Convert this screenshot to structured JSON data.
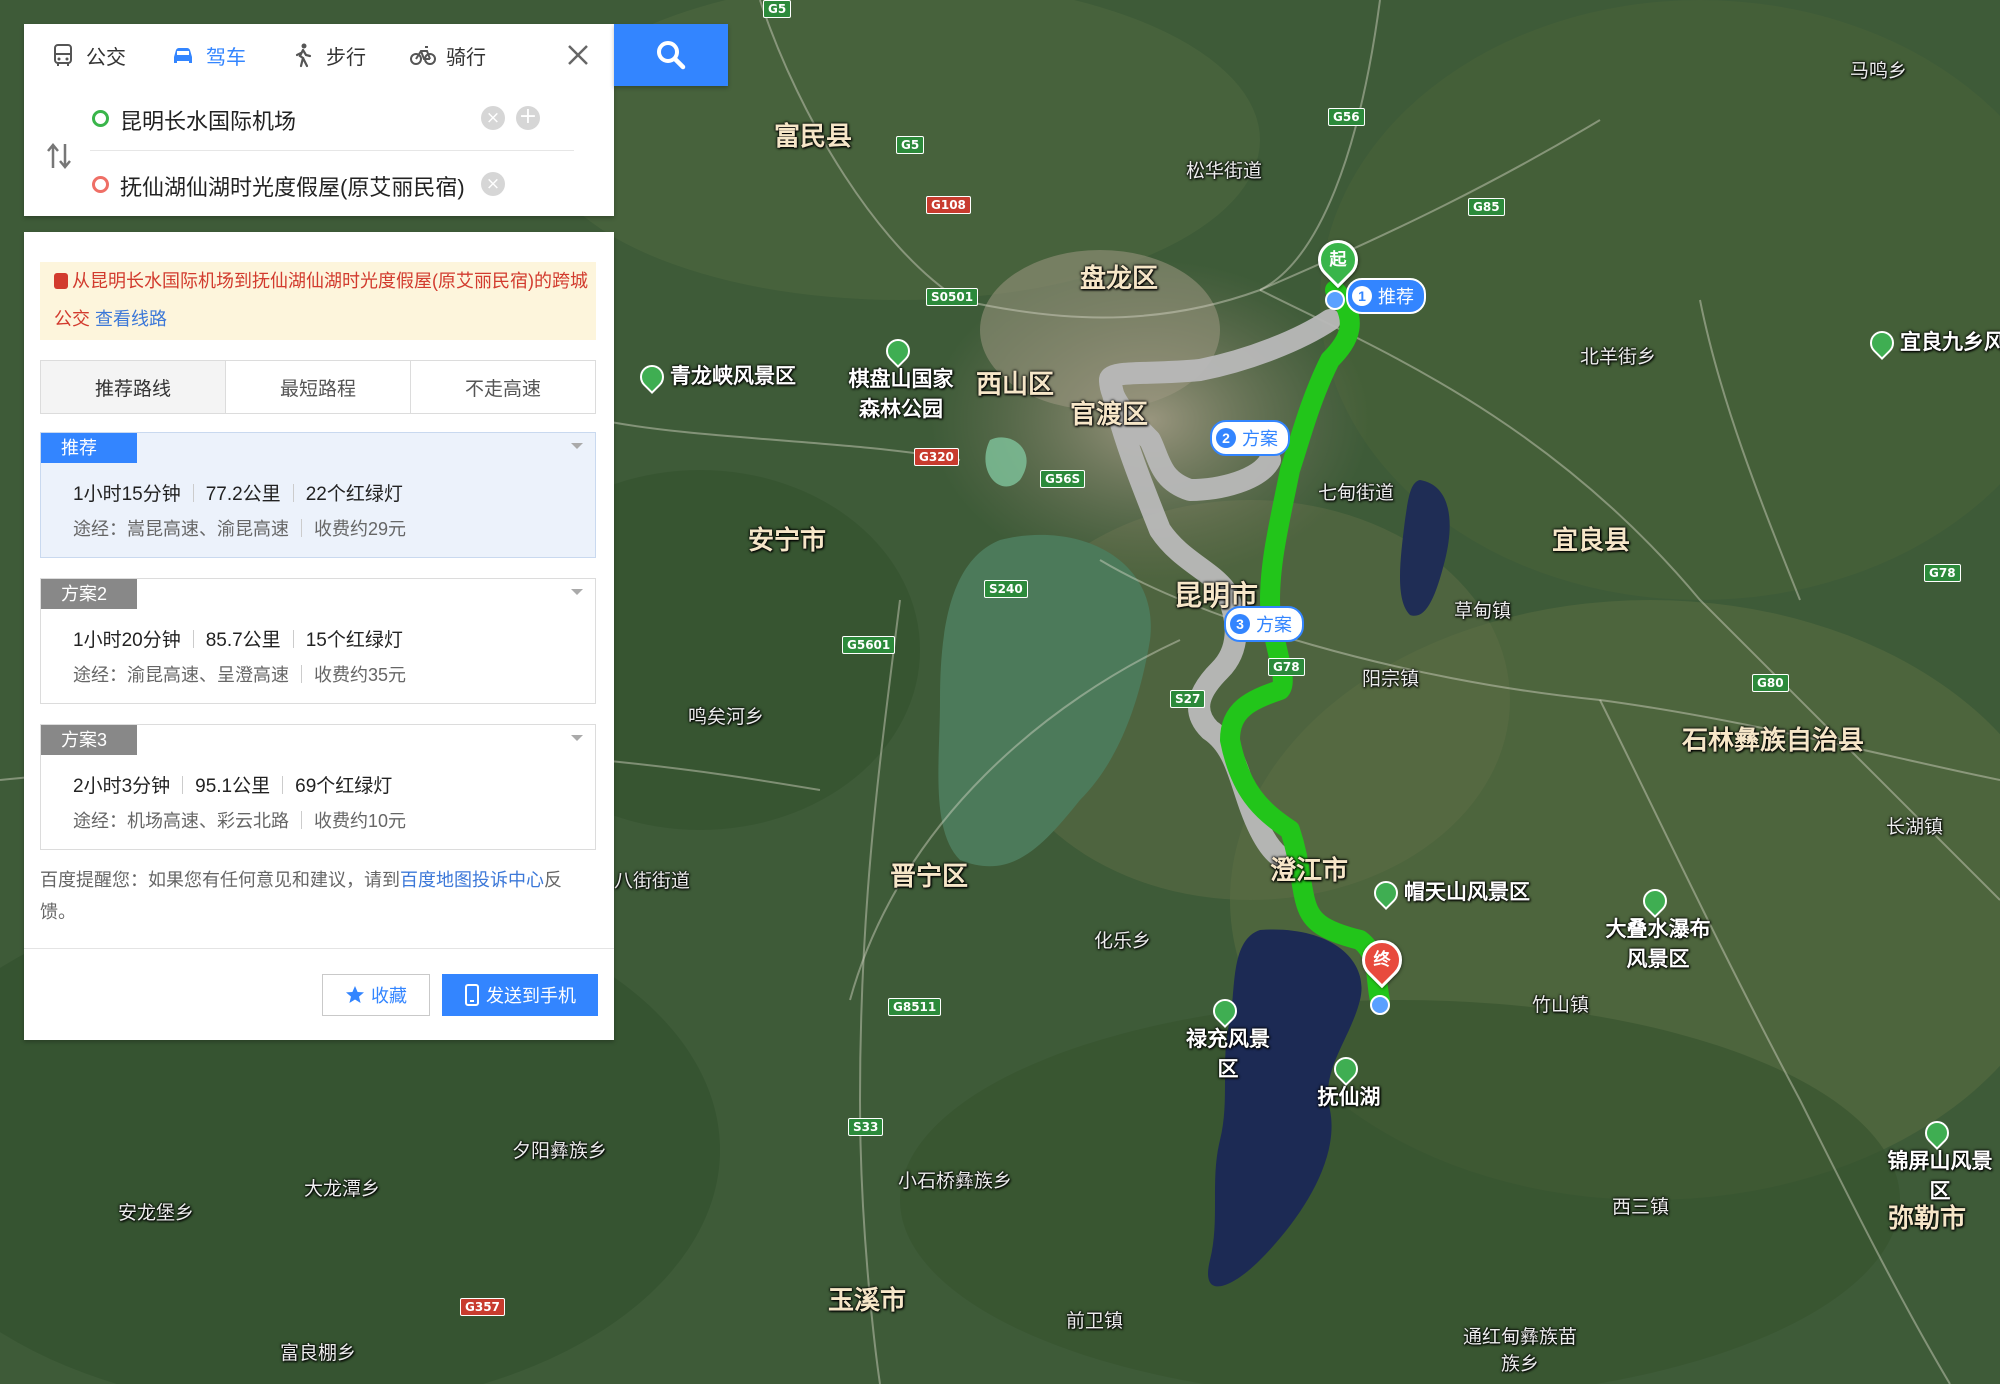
{
  "colors": {
    "accent": "#3385ff",
    "route_main": "#22c51a",
    "route_alt": "#b9b9b9",
    "start": "#39b54a",
    "end": "#e84a3d",
    "notice_text": "#d23b2e"
  },
  "search": {
    "modes": [
      {
        "label": "公交",
        "icon": "bus-icon",
        "active": false
      },
      {
        "label": "驾车",
        "icon": "car-icon",
        "active": true
      },
      {
        "label": "步行",
        "icon": "walk-icon",
        "active": false
      },
      {
        "label": "骑行",
        "icon": "bike-icon",
        "active": false
      }
    ],
    "start": "昆明长水国际机场",
    "end": "抚仙湖仙湖时光度假屋(原艾丽民宿)",
    "search_icon": "search-icon"
  },
  "notice": {
    "text": "从昆明长水国际机场到抚仙湖仙湖时光度假屋(原艾丽民宿)的跨城公交",
    "link": "查看线路"
  },
  "route_tabs": [
    "推荐路线",
    "最短路程",
    "不走高速"
  ],
  "plans": [
    {
      "tag": "推荐",
      "time": "1小时15分钟",
      "distance": "77.2公里",
      "lights": "22个红绿灯",
      "via": "途经：嵩昆高速、渝昆高速",
      "toll": "收费约29元"
    },
    {
      "tag": "方案2",
      "time": "1小时20分钟",
      "distance": "85.7公里",
      "lights": "15个红绿灯",
      "via": "途经：渝昆高速、呈澄高速",
      "toll": "收费约35元"
    },
    {
      "tag": "方案3",
      "time": "2小时3分钟",
      "distance": "95.1公里",
      "lights": "69个红绿灯",
      "via": "途经：机场高速、彩云北路",
      "toll": "收费约10元"
    }
  ],
  "tip": {
    "prefix": "百度提醒您：如果您有任何意见和建议，请到",
    "link": "百度地图投诉中心",
    "suffix": "反馈。"
  },
  "buttons": {
    "favorite": "收藏",
    "send": "发送到手机"
  },
  "map": {
    "markers": {
      "start": "起",
      "end": "终"
    },
    "bubbles": [
      {
        "num": "1",
        "label": "推荐"
      },
      {
        "num": "2",
        "label": "方案"
      },
      {
        "num": "3",
        "label": "方案"
      }
    ],
    "cities": [
      "富民县",
      "盘龙区",
      "西山区",
      "官渡区",
      "安宁市",
      "昆明市",
      "宜良县",
      "澄江市",
      "晋宁区",
      "玉溪市",
      "石林彝族自治县",
      "弥勒市"
    ],
    "towns": [
      "松华街道",
      "北羊街乡",
      "七甸街道",
      "草甸镇",
      "阳宗镇",
      "鸣矣河乡",
      "化乐乡",
      "竹山镇",
      "长湖镇",
      "马鸣乡",
      "夕阳彝族乡",
      "大龙潭乡",
      "安龙堡乡",
      "富良棚乡",
      "小石桥彝族乡",
      "前卫镇",
      "西三镇",
      "通红甸彝族苗族乡",
      "八街街道"
    ],
    "pois": [
      "青龙峡风景区",
      "棋盘山国家森林公园",
      "帽天山风景区",
      "大叠水瀑布风景区",
      "禄充风景区",
      "抚仙湖",
      "宜良九乡风",
      "锦屏山风景区"
    ],
    "road_shields": [
      "G5",
      "G56",
      "G85",
      "G108",
      "S0501",
      "G320",
      "G56S",
      "S240",
      "G5601",
      "G78",
      "S27",
      "G80",
      "G8511",
      "S33",
      "G357"
    ]
  }
}
